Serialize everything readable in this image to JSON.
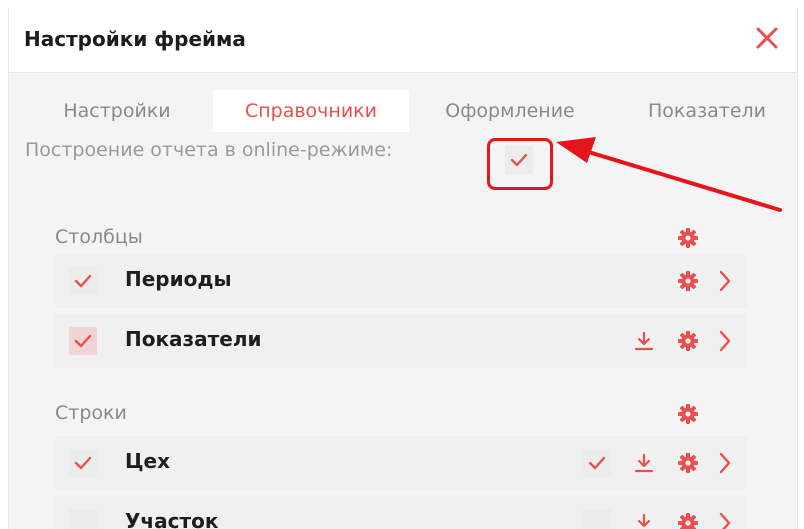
{
  "dialog": {
    "title": "Настройки фрейма",
    "close_icon": "close-icon",
    "accent_color": "#e8504f"
  },
  "tabs": [
    {
      "label": "Настройки",
      "active": false
    },
    {
      "label": "Справочники",
      "active": true
    },
    {
      "label": "Оформление",
      "active": false
    },
    {
      "label": "Показатели",
      "active": false
    }
  ],
  "online_mode": {
    "label": "Построение отчета в online-режиме:",
    "checked": true
  },
  "columns": {
    "title": "Столбцы",
    "items": [
      {
        "label": "Периоды",
        "checked": true
      },
      {
        "label": "Показатели",
        "checked": true
      }
    ]
  },
  "rows": {
    "title": "Строки",
    "items": [
      {
        "label": "Цех",
        "checked": true,
        "extra_checked": true
      },
      {
        "label": "Участок",
        "checked": false,
        "extra_checked": false
      }
    ]
  }
}
